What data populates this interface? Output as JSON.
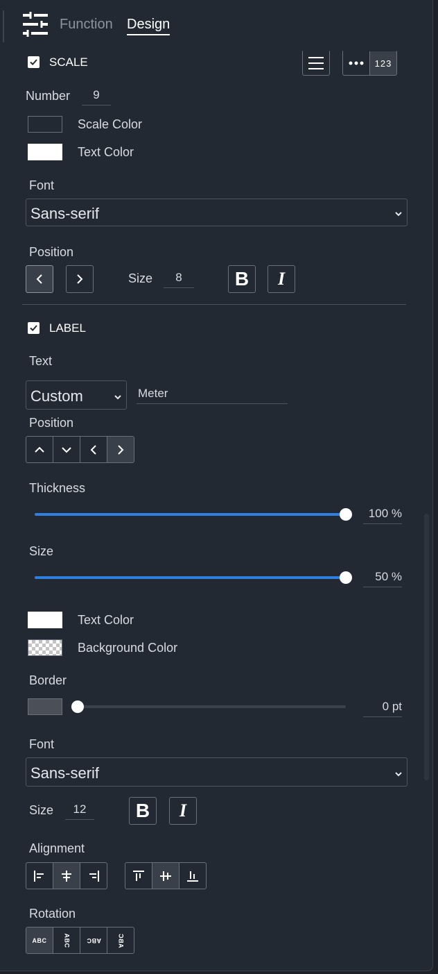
{
  "tabs": {
    "function": "Function",
    "design": "Design"
  },
  "scale": {
    "title": "SCALE",
    "checked": true,
    "number_label": "Number",
    "number_value": "9",
    "scale_color_label": "Scale Color",
    "scale_color": "#222933",
    "text_color_label": "Text Color",
    "text_color": "#ffffff",
    "font_label": "Font",
    "font_value": "Sans-serif",
    "position_label": "Position",
    "size_label": "Size",
    "size_value": "8",
    "bold_label": "B",
    "italic_label": "I",
    "numbers_button_label": "123"
  },
  "label": {
    "title": "LABEL",
    "checked": true,
    "text_label": "Text",
    "text_mode": "Custom",
    "text_value": "Meter",
    "position_label": "Position",
    "thickness_label": "Thickness",
    "thickness_value": "100 %",
    "thickness_percent": 100,
    "size_label": "Size",
    "size_value": "50 %",
    "size_slider_percent": 100,
    "text_color_label": "Text Color",
    "text_color": "#ffffff",
    "background_color_label": "Background Color",
    "border_label": "Border",
    "border_value": "0 pt",
    "border_percent": 0,
    "border_color": "#4b5058",
    "font_label": "Font",
    "font_value": "Sans-serif",
    "font_size_label": "Size",
    "font_size_value": "12",
    "bold_label": "B",
    "italic_label": "I",
    "alignment_label": "Alignment",
    "rotation_label": "Rotation",
    "rotation_text": "ABC"
  },
  "colors": {
    "accent": "#2f7fe0",
    "panel": "#222933"
  }
}
